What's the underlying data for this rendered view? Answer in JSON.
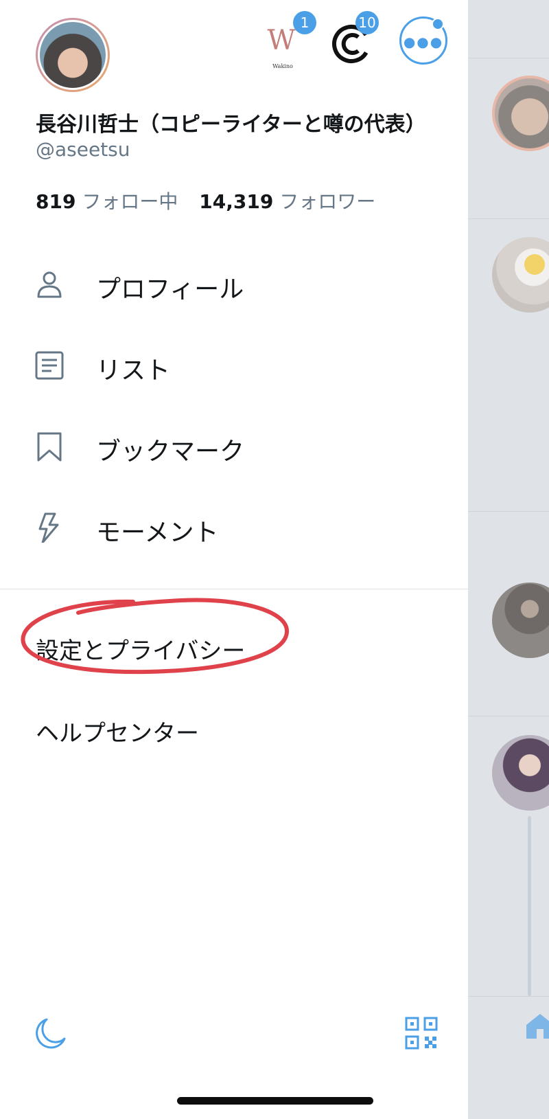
{
  "profile": {
    "display_name": "長谷川哲士（コピーライターと噂の代表）",
    "handle": "@aseetsu",
    "following_count": "819",
    "following_label": "フォロー中",
    "followers_count": "14,319",
    "followers_label": "フォロワー"
  },
  "accounts": [
    {
      "icon": "wakino-logo",
      "logo_text": "W",
      "sub_text": "Wakino",
      "badge": "1"
    },
    {
      "icon": "c-logo",
      "badge": "10"
    }
  ],
  "menu": {
    "items": [
      {
        "icon": "person-icon",
        "label": "プロフィール"
      },
      {
        "icon": "list-icon",
        "label": "リスト"
      },
      {
        "icon": "bookmark-icon",
        "label": "ブックマーク"
      },
      {
        "icon": "lightning-icon",
        "label": "モーメント"
      }
    ],
    "settings_label": "設定とプライバシー",
    "help_label": "ヘルプセンター"
  },
  "colors": {
    "accent": "#4a9fe6",
    "annotation": "#e0424b",
    "secondary_text": "#657786"
  }
}
